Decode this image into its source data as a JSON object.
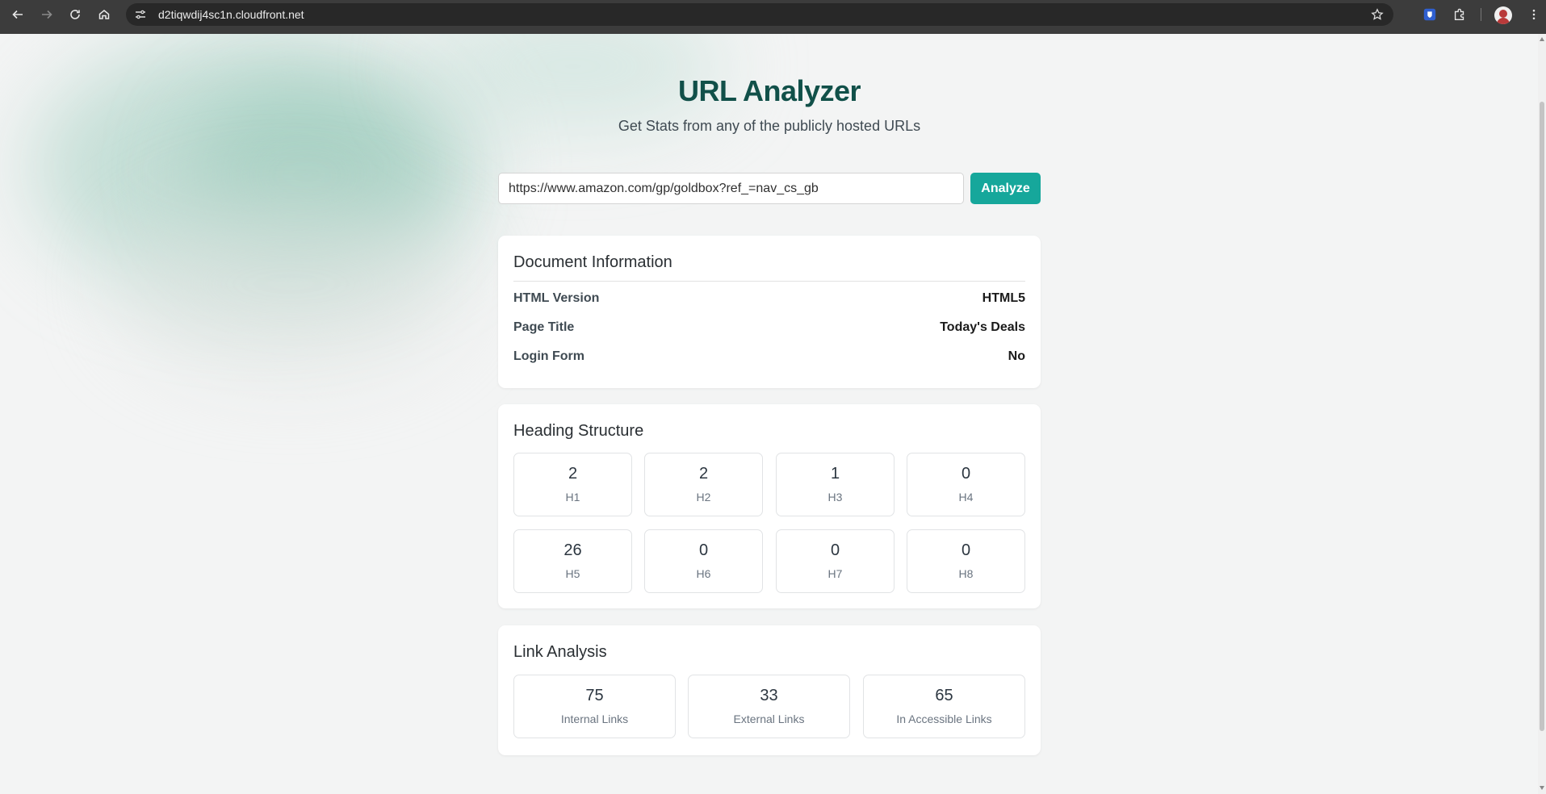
{
  "browser": {
    "url": "d2tiqwdij4sc1n.cloudfront.net"
  },
  "page": {
    "title": "URL Analyzer",
    "subtitle": "Get Stats from any of the publicly hosted URLs"
  },
  "form": {
    "url_value": "https://www.amazon.com/gp/goldbox?ref_=nav_cs_gb",
    "analyze_label": "Analyze"
  },
  "document_info": {
    "title": "Document Information",
    "rows": [
      {
        "label": "HTML Version",
        "value": "HTML5"
      },
      {
        "label": "Page Title",
        "value": "Today's Deals"
      },
      {
        "label": "Login Form",
        "value": "No"
      }
    ]
  },
  "headings": {
    "title": "Heading Structure",
    "items": [
      {
        "count": "2",
        "tag": "H1"
      },
      {
        "count": "2",
        "tag": "H2"
      },
      {
        "count": "1",
        "tag": "H3"
      },
      {
        "count": "0",
        "tag": "H4"
      },
      {
        "count": "26",
        "tag": "H5"
      },
      {
        "count": "0",
        "tag": "H6"
      },
      {
        "count": "0",
        "tag": "H7"
      },
      {
        "count": "0",
        "tag": "H8"
      }
    ]
  },
  "links": {
    "title": "Link Analysis",
    "items": [
      {
        "count": "75",
        "label": "Internal Links"
      },
      {
        "count": "33",
        "label": "External Links"
      },
      {
        "count": "65",
        "label": "In Accessible Links"
      }
    ]
  },
  "colors": {
    "accent": "#16a79b",
    "title": "#115049"
  }
}
